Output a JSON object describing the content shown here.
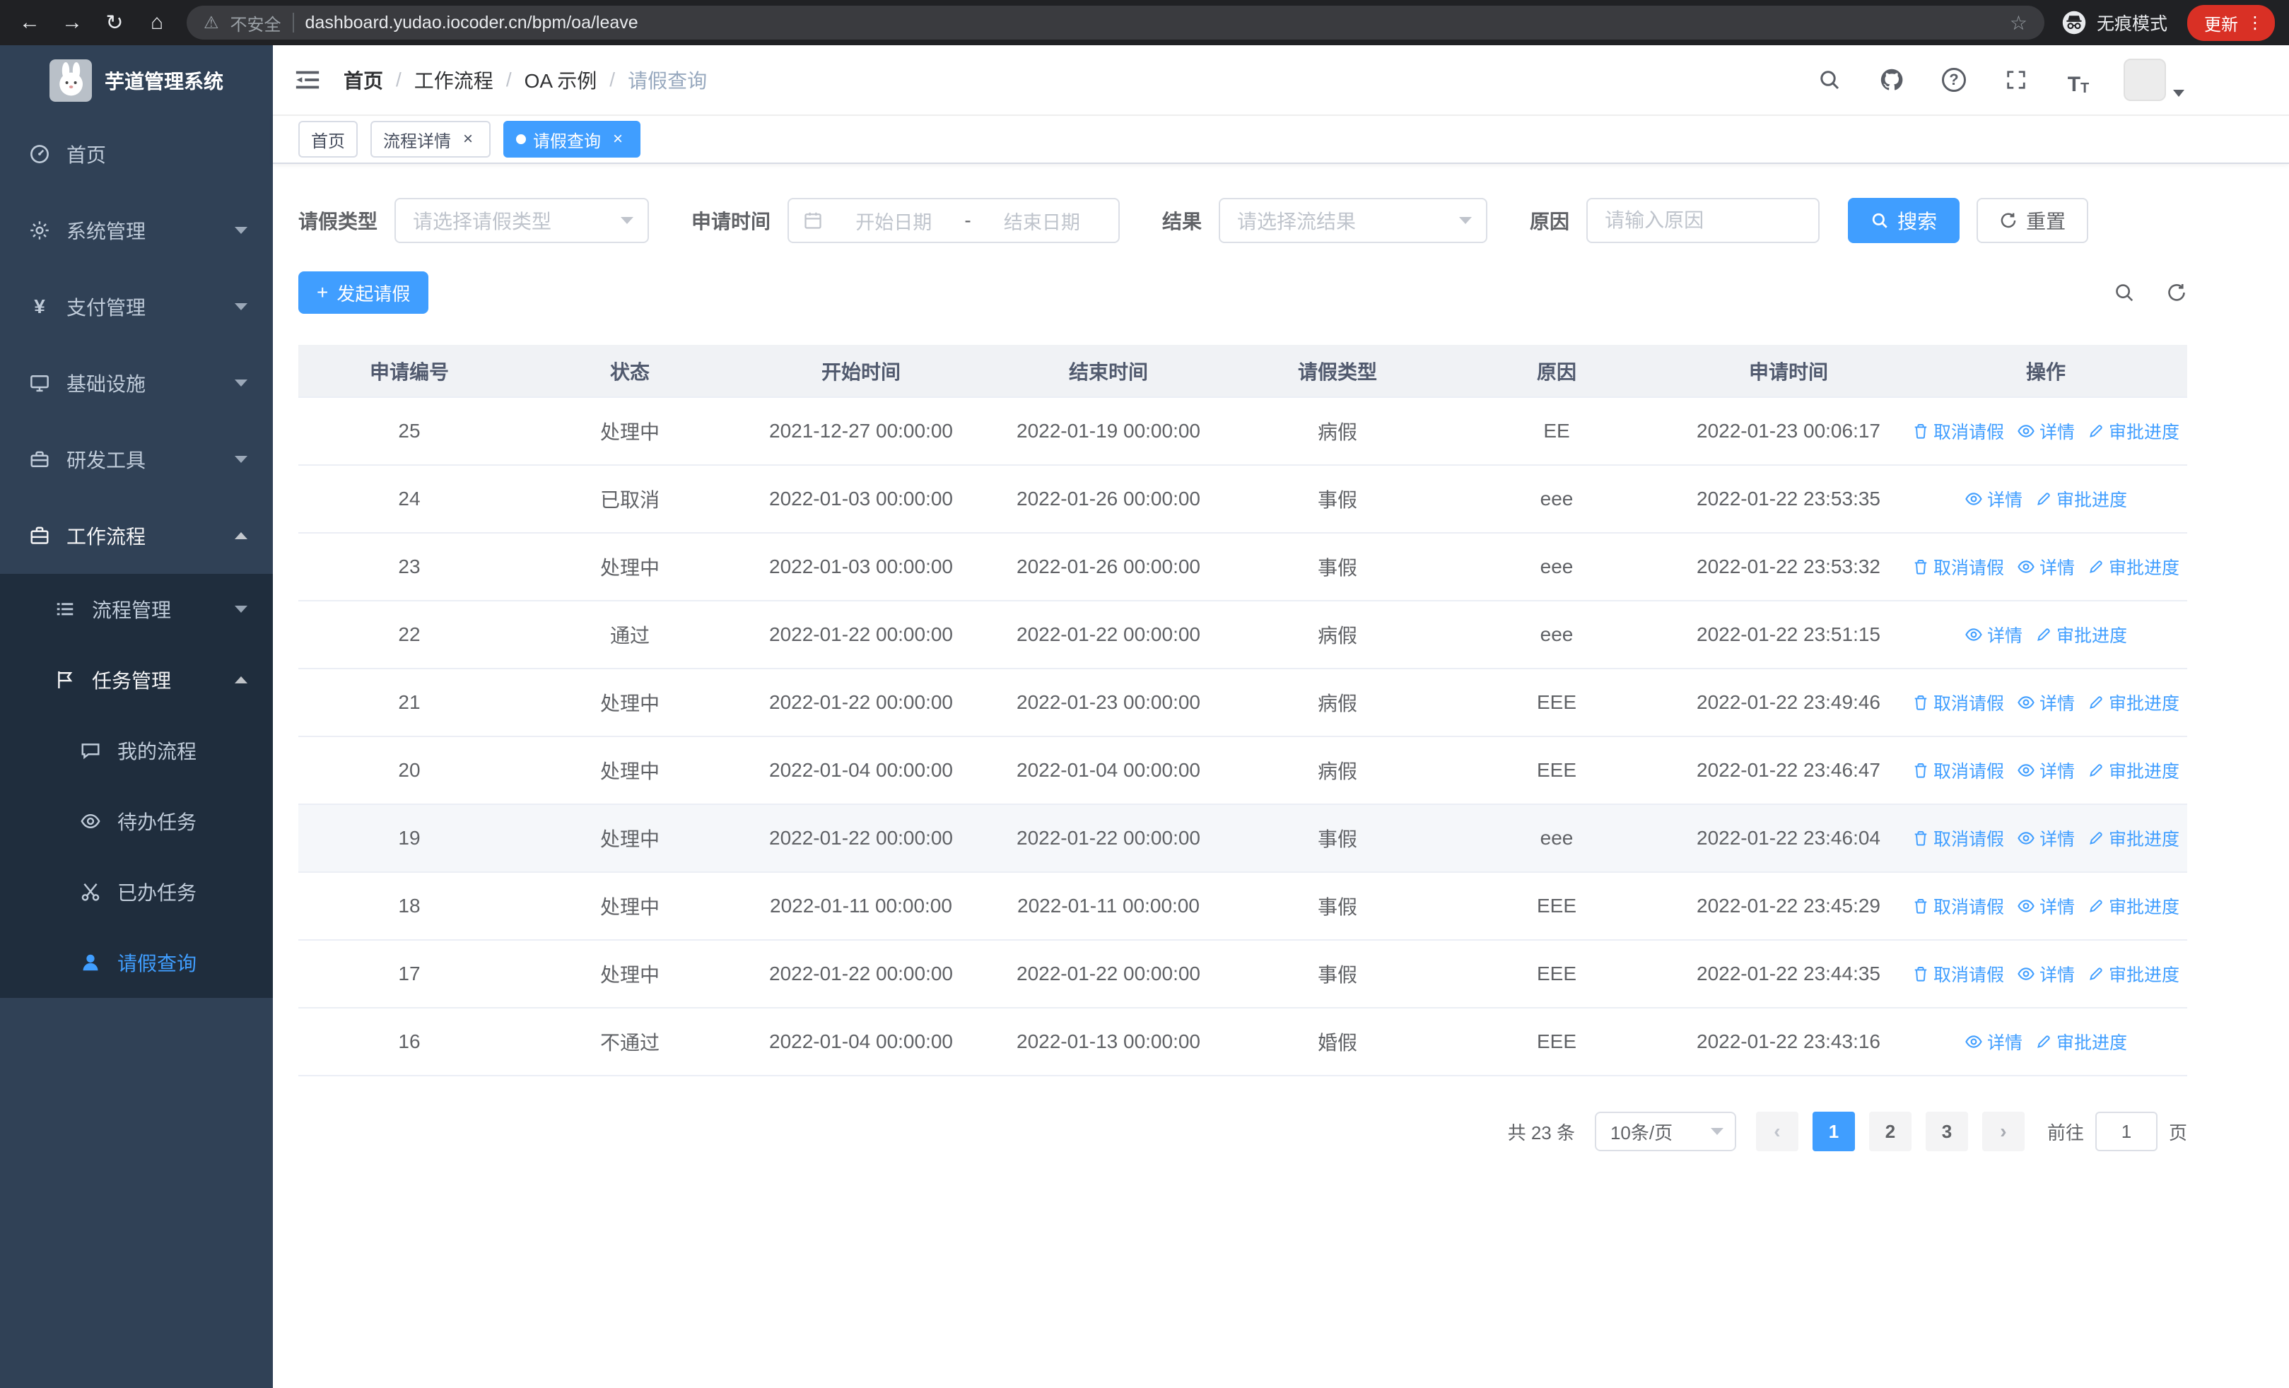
{
  "browser": {
    "security_label": "不安全",
    "url": "dashboard.yudao.iocoder.cn/bpm/oa/leave",
    "incognito_label": "无痕模式",
    "update_label": "更新"
  },
  "sidebar": {
    "app_title": "芋道管理系统",
    "home": "首页",
    "system": "系统管理",
    "pay": "支付管理",
    "infra": "基础设施",
    "devtools": "研发工具",
    "workflow": "工作流程",
    "process_mgmt": "流程管理",
    "task_mgmt": "任务管理",
    "my_process": "我的流程",
    "todo_tasks": "待办任务",
    "done_tasks": "已办任务",
    "leave_query": "请假查询"
  },
  "header": {
    "breadcrumb": [
      "首页",
      "工作流程",
      "OA 示例",
      "请假查询"
    ]
  },
  "tabs": {
    "home": "首页",
    "process_detail": "流程详情",
    "leave_query": "请假查询"
  },
  "filters": {
    "leave_type_label": "请假类型",
    "leave_type_placeholder": "请选择请假类型",
    "apply_time_label": "申请时间",
    "start_date_placeholder": "开始日期",
    "range_separator": "-",
    "end_date_placeholder": "结束日期",
    "result_label": "结果",
    "result_placeholder": "请选择流结果",
    "reason_label": "原因",
    "reason_placeholder": "请输入原因",
    "search_label": "搜索",
    "reset_label": "重置"
  },
  "toolbar": {
    "create_label": "发起请假"
  },
  "table": {
    "columns": [
      "申请编号",
      "状态",
      "开始时间",
      "结束时间",
      "请假类型",
      "原因",
      "申请时间",
      "操作"
    ],
    "action_labels": {
      "cancel": "取消请假",
      "detail": "详情",
      "progress": "审批进度"
    },
    "rows": [
      {
        "id": "25",
        "status": "处理中",
        "start": "2021-12-27 00:00:00",
        "end": "2022-01-19 00:00:00",
        "type": "病假",
        "reason": "EE",
        "apply_time": "2022-01-23 00:06:17",
        "actions": [
          "cancel",
          "detail",
          "progress"
        ],
        "highlight": false
      },
      {
        "id": "24",
        "status": "已取消",
        "start": "2022-01-03 00:00:00",
        "end": "2022-01-26 00:00:00",
        "type": "事假",
        "reason": "eee",
        "apply_time": "2022-01-22 23:53:35",
        "actions": [
          "detail",
          "progress"
        ],
        "highlight": false
      },
      {
        "id": "23",
        "status": "处理中",
        "start": "2022-01-03 00:00:00",
        "end": "2022-01-26 00:00:00",
        "type": "事假",
        "reason": "eee",
        "apply_time": "2022-01-22 23:53:32",
        "actions": [
          "cancel",
          "detail",
          "progress"
        ],
        "highlight": false
      },
      {
        "id": "22",
        "status": "通过",
        "start": "2022-01-22 00:00:00",
        "end": "2022-01-22 00:00:00",
        "type": "病假",
        "reason": "eee",
        "apply_time": "2022-01-22 23:51:15",
        "actions": [
          "detail",
          "progress"
        ],
        "highlight": false
      },
      {
        "id": "21",
        "status": "处理中",
        "start": "2022-01-22 00:00:00",
        "end": "2022-01-23 00:00:00",
        "type": "病假",
        "reason": "EEE",
        "apply_time": "2022-01-22 23:49:46",
        "actions": [
          "cancel",
          "detail",
          "progress"
        ],
        "highlight": false
      },
      {
        "id": "20",
        "status": "处理中",
        "start": "2022-01-04 00:00:00",
        "end": "2022-01-04 00:00:00",
        "type": "病假",
        "reason": "EEE",
        "apply_time": "2022-01-22 23:46:47",
        "actions": [
          "cancel",
          "detail",
          "progress"
        ],
        "highlight": false
      },
      {
        "id": "19",
        "status": "处理中",
        "start": "2022-01-22 00:00:00",
        "end": "2022-01-22 00:00:00",
        "type": "事假",
        "reason": "eee",
        "apply_time": "2022-01-22 23:46:04",
        "actions": [
          "cancel",
          "detail",
          "progress"
        ],
        "highlight": true
      },
      {
        "id": "18",
        "status": "处理中",
        "start": "2022-01-11 00:00:00",
        "end": "2022-01-11 00:00:00",
        "type": "事假",
        "reason": "EEE",
        "apply_time": "2022-01-22 23:45:29",
        "actions": [
          "cancel",
          "detail",
          "progress"
        ],
        "highlight": false
      },
      {
        "id": "17",
        "status": "处理中",
        "start": "2022-01-22 00:00:00",
        "end": "2022-01-22 00:00:00",
        "type": "事假",
        "reason": "EEE",
        "apply_time": "2022-01-22 23:44:35",
        "actions": [
          "cancel",
          "detail",
          "progress"
        ],
        "highlight": false
      },
      {
        "id": "16",
        "status": "不通过",
        "start": "2022-01-04 00:00:00",
        "end": "2022-01-13 00:00:00",
        "type": "婚假",
        "reason": "EEE",
        "apply_time": "2022-01-22 23:43:16",
        "actions": [
          "detail",
          "progress"
        ],
        "highlight": false
      }
    ]
  },
  "pagination": {
    "total_label": "共 23 条",
    "page_size_label": "10条/页",
    "pages": [
      "1",
      "2",
      "3"
    ],
    "active_page": "1",
    "goto_label": "前往",
    "goto_value": "1",
    "page_unit_label": "页"
  },
  "colors": {
    "accent": "#409eff",
    "sidebar_bg": "#304156",
    "submenu_bg": "#1f2d3d",
    "chrome_bg": "#202124",
    "update_pill": "#d93025"
  }
}
